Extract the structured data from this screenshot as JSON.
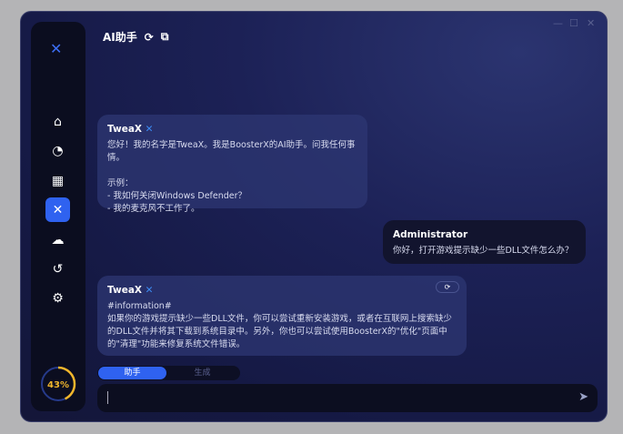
{
  "window": {
    "title": "AI助手",
    "controls": [
      "—",
      "☐",
      "✕"
    ]
  },
  "sidebar": {
    "logo": "✕",
    "items": [
      {
        "name": "home",
        "icon": "⌂"
      },
      {
        "name": "performance",
        "icon": "◔"
      },
      {
        "name": "apps",
        "icon": "▦"
      },
      {
        "name": "tweax",
        "icon": "✕",
        "active": true
      },
      {
        "name": "cloud",
        "icon": "☁"
      },
      {
        "name": "restore",
        "icon": "↺"
      },
      {
        "name": "settings",
        "icon": "⚙"
      }
    ],
    "gauge": {
      "value": 43,
      "label": "43%",
      "color": "#f2b62c"
    }
  },
  "messages": [
    {
      "sender": "TweaX",
      "lines": [
        "您好！我的名字是TweaX。我是BoosterX的AI助手。问我任何事情。",
        "",
        "示例：",
        "- 我如何关闭Windows Defender？",
        "- 我的麦克风不工作了。"
      ]
    },
    {
      "sender": "Administrator",
      "lines": [
        "你好，打开游戏提示缺少一些DLL文件怎么办？"
      ]
    },
    {
      "sender": "TweaX",
      "lines": [
        "#information#",
        "如果你的游戏提示缺少一些DLL文件，你可以尝试重新安装游戏，或者在互联网上搜索缺少",
        "的DLL文件并将其下载到系统目录中。另外，你也可以尝试使用BoosterX的\"优化\"页面中",
        "的\"清理\"功能来修复系统文件错误。"
      ]
    }
  ],
  "mode_tabs": [
    "助手",
    "生成"
  ],
  "input": {
    "value": ""
  },
  "accent": "#2f62f0"
}
